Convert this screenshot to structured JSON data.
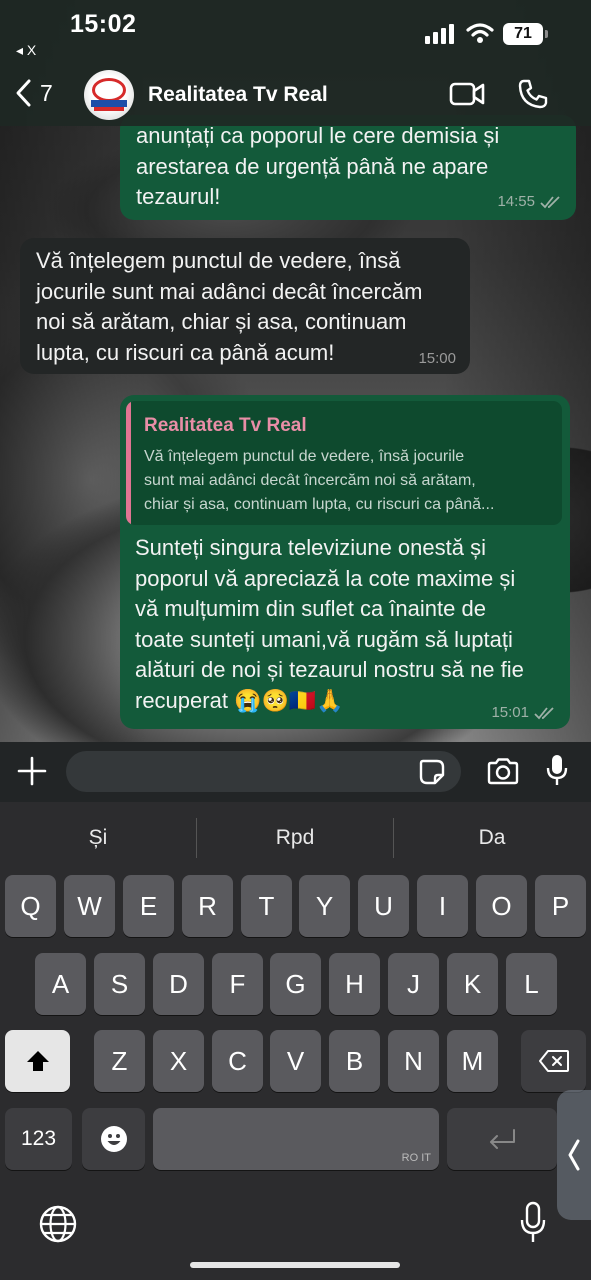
{
  "status_bar": {
    "time": "15:02",
    "back_app": "◂ X",
    "battery": "71"
  },
  "header": {
    "back_count": "7",
    "title": "Realitatea Tv Real"
  },
  "messages": [
    {
      "direction": "outgoing",
      "lines": [
        "anunțați ca poporul le cere demisia și",
        "arestarea de urgență până ne apare",
        "tezaurul!"
      ],
      "time": "14:55",
      "status": "read"
    },
    {
      "direction": "incoming",
      "lines": [
        "Vă înțelegem punctul de vedere, însă",
        "jocurile sunt mai adânci decât încercăm",
        "noi să arătam, chiar și asa, continuam",
        "lupta, cu riscuri ca până acum!"
      ],
      "time": "15:00"
    },
    {
      "direction": "outgoing",
      "quote": {
        "author": "Realitatea Tv Real",
        "lines": [
          "Vă înțelegem punctul de vedere, însă jocurile",
          "sunt mai adânci decât încercăm noi să arătam,",
          "chiar și asa, continuam lupta, cu riscuri ca până..."
        ]
      },
      "lines": [
        "Sunteți singura televiziune onestă și",
        "poporul vă apreciază la cote maxime și",
        "vă mulțumim din suflet ca înainte de",
        "toate sunteți umani,vă rugăm să luptați",
        "alături de noi și tezaurul nostru să ne fie",
        "recuperat 😭🥺🇷🇴🙏"
      ],
      "time": "15:01",
      "status": "read"
    }
  ],
  "composer": {
    "placeholder": ""
  },
  "keyboard": {
    "suggestions": [
      "Și",
      "Rpd",
      "Da"
    ],
    "row1": [
      "Q",
      "W",
      "E",
      "R",
      "T",
      "Y",
      "U",
      "I",
      "O",
      "P"
    ],
    "row2": [
      "A",
      "S",
      "D",
      "F",
      "G",
      "H",
      "J",
      "K",
      "L"
    ],
    "row3": [
      "Z",
      "X",
      "C",
      "V",
      "B",
      "N",
      "M"
    ],
    "numbers_key": "123",
    "space_hint": "RO IT"
  },
  "colors": {
    "outgoing_bubble": "#135a3a",
    "incoming_bubble": "#232626",
    "quote_accent": "#e07593"
  }
}
